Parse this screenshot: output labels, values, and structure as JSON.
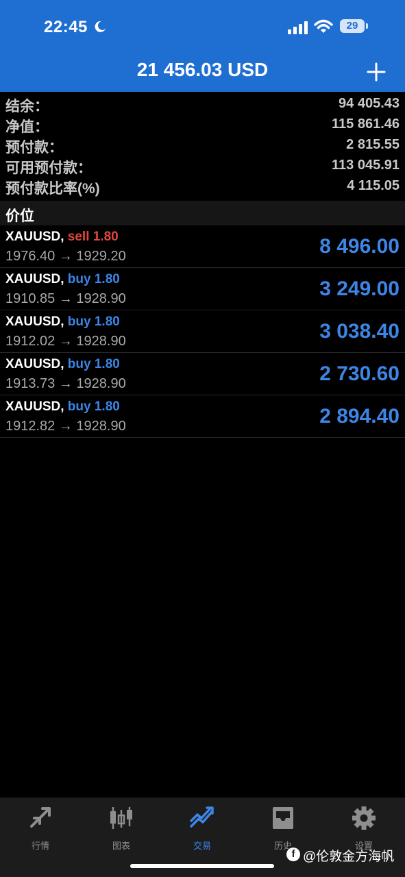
{
  "status_bar": {
    "time": "22:45",
    "battery": "29"
  },
  "header": {
    "title": "21 456.03 USD"
  },
  "summary": [
    {
      "label": "结余：",
      "value": "94 405.43"
    },
    {
      "label": "净值：",
      "value": "115 861.46"
    },
    {
      "label": "预付款：",
      "value": "2 815.55"
    },
    {
      "label": "可用预付款：",
      "value": "113 045.91"
    },
    {
      "label": "预付款比率(%)",
      "value": "4 115.05"
    }
  ],
  "section": {
    "title": "价位"
  },
  "positions": [
    {
      "symbol": "XAUUSD,",
      "side": "sell 1.80",
      "prices": "1976.40 → 1929.20",
      "profit": "8 496.00"
    },
    {
      "symbol": "XAUUSD,",
      "side": "buy 1.80",
      "prices": "1910.85 → 1928.90",
      "profit": "3 249.00"
    },
    {
      "symbol": "XAUUSD,",
      "side": "buy 1.80",
      "prices": "1912.02 → 1928.90",
      "profit": "3 038.40"
    },
    {
      "symbol": "XAUUSD,",
      "side": "buy 1.80",
      "prices": "1913.73 → 1928.90",
      "profit": "2 730.60"
    },
    {
      "symbol": "XAUUSD,",
      "side": "buy 1.80",
      "prices": "1912.82 → 1928.90",
      "profit": "2 894.40"
    }
  ],
  "tabs": [
    {
      "label": "行情",
      "icon": "quotes-arrows-icon"
    },
    {
      "label": "图表",
      "icon": "candlestick-chart-icon"
    },
    {
      "label": "交易",
      "icon": "trade-trend-icon"
    },
    {
      "label": "历史",
      "icon": "history-inbox-icon"
    },
    {
      "label": "设置",
      "icon": "gear-icon"
    }
  ],
  "watermark": {
    "text": "@伦敦金方海帆"
  },
  "colors": {
    "header_blue": "#1f6fd3",
    "sell_red": "#e0473f",
    "buy_blue": "#3d86e8"
  }
}
